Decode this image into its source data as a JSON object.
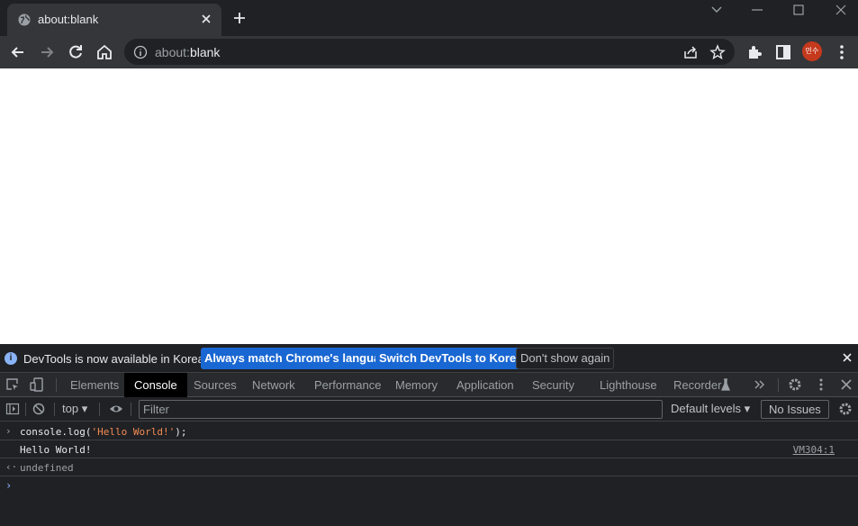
{
  "tab": {
    "title": "about:blank"
  },
  "omnibox": {
    "url_scheme": "about:",
    "url_path": "blank"
  },
  "avatar": {
    "text": "민수"
  },
  "devtools": {
    "infobar": {
      "message": "DevTools is now available in Korean!",
      "btn_match": "Always match Chrome's language",
      "btn_switch": "Switch DevTools to Korean",
      "btn_dismiss": "Don't show again"
    },
    "tabs": [
      "Elements",
      "Console",
      "Sources",
      "Network",
      "Performance",
      "Memory",
      "Application",
      "Security",
      "Lighthouse",
      "Recorder"
    ],
    "active_tab": "Console",
    "console_toolbar": {
      "context": "top",
      "filter_placeholder": "Filter",
      "levels": "Default levels",
      "issues": "No Issues"
    },
    "console": {
      "input_prefix": "console.log(",
      "input_string": "'Hello World!'",
      "input_suffix": ");",
      "output": "Hello World!",
      "output_source": "VM304:1",
      "return_value": "undefined"
    }
  },
  "colors": {
    "accent": "#1967d2",
    "string": "#f28b54",
    "avatar": "#c5391d"
  }
}
